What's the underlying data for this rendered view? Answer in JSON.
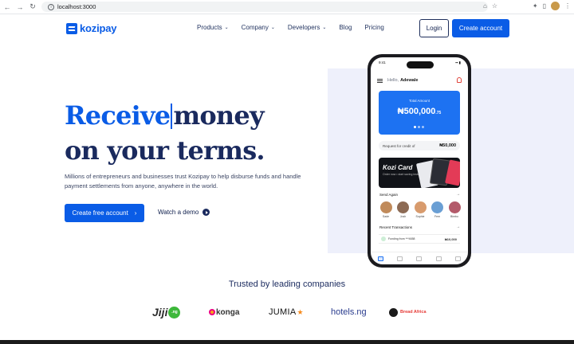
{
  "browser": {
    "url": "localhost:3000",
    "nav": {
      "back": "←",
      "forward": "→",
      "reload": "↻"
    }
  },
  "header": {
    "logo": "kozipay",
    "nav": [
      {
        "label": "Products",
        "caret": true
      },
      {
        "label": "Company",
        "caret": true
      },
      {
        "label": "Developers",
        "caret": true
      },
      {
        "label": "Blog",
        "caret": false
      },
      {
        "label": "Pricing",
        "caret": false
      }
    ],
    "login": "Login",
    "create_account": "Create account"
  },
  "hero": {
    "headline_accent": "Receive",
    "headline_rest": "money",
    "headline_line2": "on your terms.",
    "subtitle": "Millions of entrepreneurs and businesses trust Kozipay to help disburse funds and handle payment settlements from anyone, anywhere in the world.",
    "cta": "Create free account",
    "watch": "Watch a demo"
  },
  "phone": {
    "time": "9:41",
    "greeting": "Hello,",
    "user": "Adewale",
    "balance_label": "Total Amount",
    "balance": "₦500,000",
    "balance_suffix": ".75",
    "credit_label": "Request for credit of",
    "credit_amount": "₦50,000",
    "card_title": "Kozi Card",
    "card_sub": "Order now • start saving instantly",
    "send_again": "Send Again",
    "contacts": [
      {
        "name": "Sade",
        "color": "#c08a5a"
      },
      {
        "name": "Josh",
        "color": "#8c6a54"
      },
      {
        "name": "Sophie",
        "color": "#d89b6d"
      },
      {
        "name": "Fem",
        "color": "#6a9fd4"
      },
      {
        "name": "Bimbo",
        "color": "#b35a6a"
      }
    ],
    "recent_label": "Recent Transactions",
    "txn_label": "Funding from ***4658",
    "txn_amount": "₦10,000"
  },
  "trusted": {
    "title": "Trusted by leading companies",
    "logos": {
      "jiji": "Jiji",
      "jiji_badge": ".ng",
      "konga": "konga",
      "jumia": "JUMIA",
      "hotels": "hotels.ng",
      "bread": "Bread Africa"
    }
  }
}
